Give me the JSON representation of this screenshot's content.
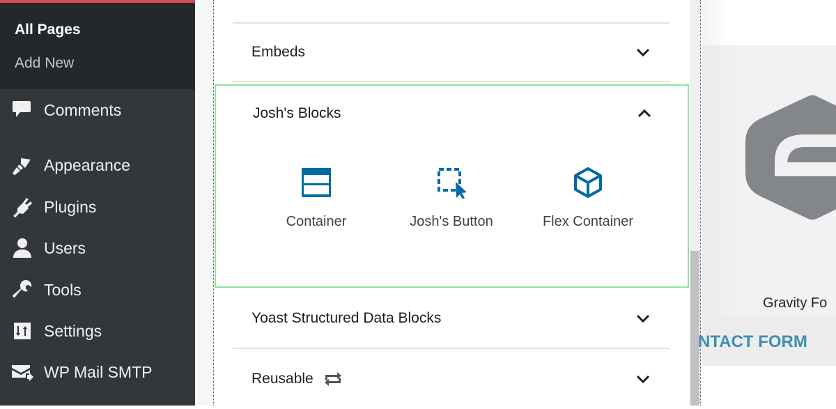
{
  "sidebar": {
    "submenu": [
      {
        "label": "All Pages",
        "current": true
      },
      {
        "label": "Add New",
        "current": false
      }
    ],
    "items": [
      {
        "label": "Comments",
        "icon": "comment-icon"
      },
      {
        "label": "Appearance",
        "icon": "paintbrush-icon"
      },
      {
        "label": "Plugins",
        "icon": "plugin-icon"
      },
      {
        "label": "Users",
        "icon": "user-icon"
      },
      {
        "label": "Tools",
        "icon": "wrench-icon"
      },
      {
        "label": "Settings",
        "icon": "settings-icon"
      },
      {
        "label": "WP Mail SMTP",
        "icon": "mail-icon"
      }
    ]
  },
  "inserter": {
    "sections": [
      {
        "label": "",
        "expanded": false
      },
      {
        "label": "Embeds",
        "expanded": false
      },
      {
        "label": "Josh's Blocks",
        "expanded": true,
        "blocks": [
          {
            "label": "Container",
            "icon": "container-icon"
          },
          {
            "label": "Josh's Button",
            "icon": "button-select-icon"
          },
          {
            "label": "Flex Container",
            "icon": "cube-icon"
          }
        ]
      },
      {
        "label": "Yoast Structured Data Blocks",
        "expanded": false
      },
      {
        "label": "Reusable",
        "expanded": false,
        "icon": "reusable-icon"
      }
    ]
  },
  "preview": {
    "title": "Gravity Fo",
    "banner": "NTACT FORM"
  },
  "colors": {
    "accent": "#006ba1",
    "sidebar": "#32373c",
    "highlight": "#8fe39c",
    "banner": "#3f8fb0"
  }
}
